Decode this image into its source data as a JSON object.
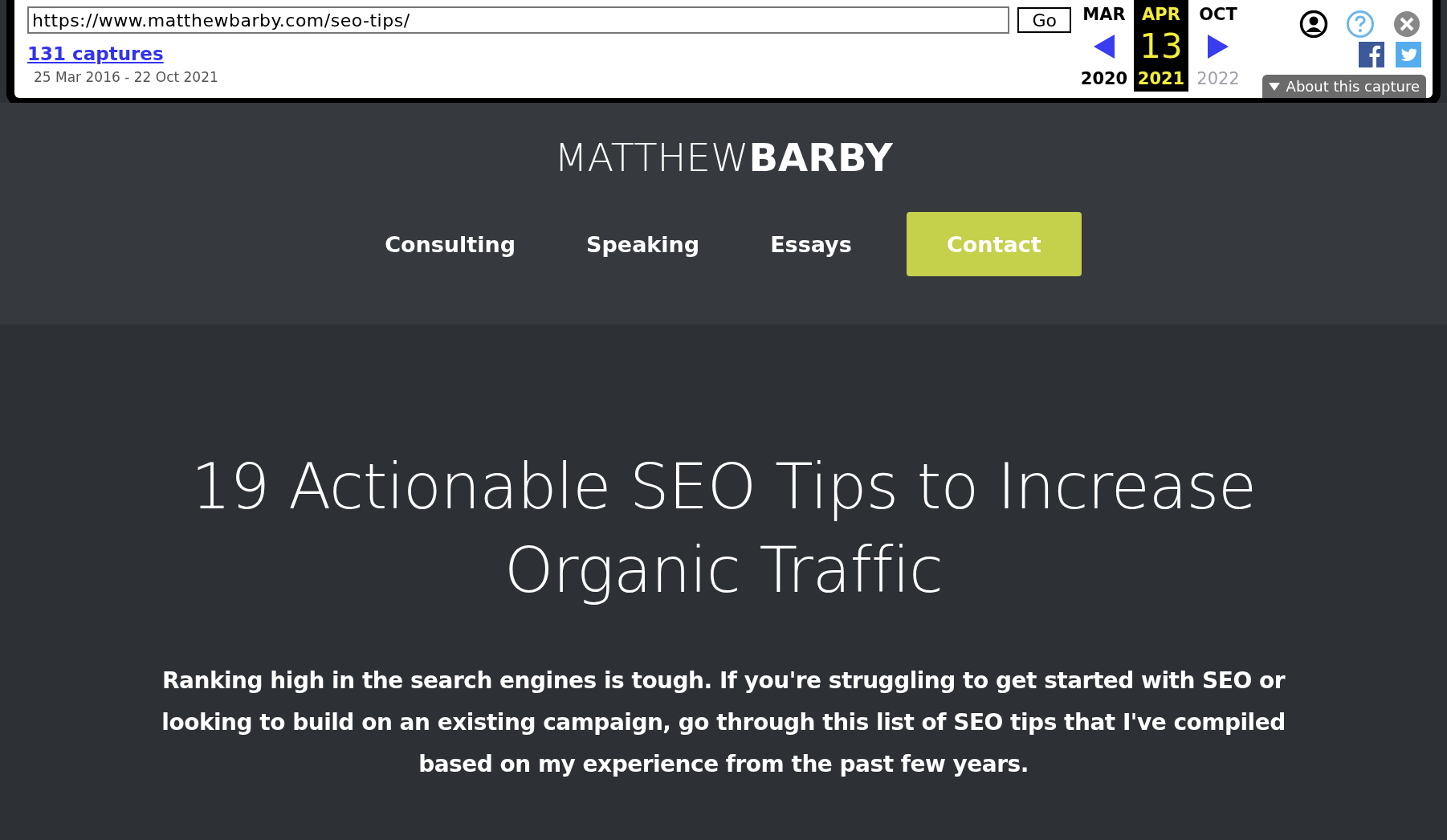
{
  "wayback_toolbar": {
    "url": "https://www.matthewbarby.com/seo-tips/",
    "go_button": "Go",
    "captures_link": "131 captures",
    "date_range": "25 Mar 2016 - 22 Oct 2021",
    "calendar": [
      {
        "month": "MAR",
        "year": "2020",
        "selected": false,
        "disabled": false
      },
      {
        "month": "APR",
        "day": "13",
        "year": "2021",
        "selected": true,
        "disabled": false
      },
      {
        "month": "OCT",
        "year": "2022",
        "selected": false,
        "disabled": true
      }
    ],
    "about_button": "About this capture"
  },
  "header": {
    "logo": "MATTHEW**BARBY**",
    "nav": [
      {
        "label": "Consulting",
        "kind": "link"
      },
      {
        "label": "Speaking",
        "kind": "link"
      },
      {
        "label": "Essays",
        "kind": "link"
      },
      {
        "label": "Contact",
        "kind": "button"
      }
    ]
  },
  "hero": {
    "title": "19 Actionable SEO Tips to Increase Organic Traffic",
    "intro": "Ranking high in the search engines is tough. If you're struggling to get started with SEO or looking to build on an existing campaign, go through this list of SEO tips that I've compiled based on my experience from the past few years."
  }
}
